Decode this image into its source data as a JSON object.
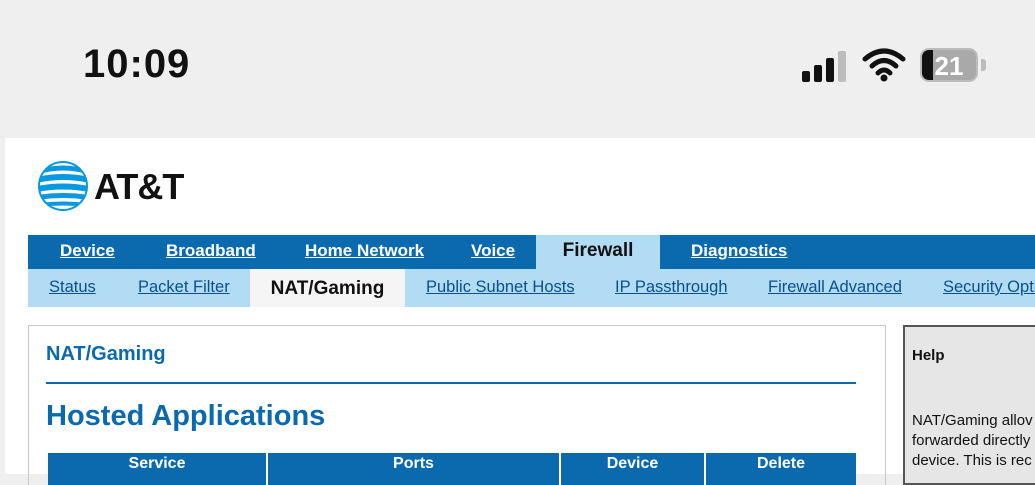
{
  "status_bar": {
    "time": "10:09",
    "battery": {
      "percent": 21,
      "label": "21"
    }
  },
  "brand": {
    "name": "AT&T",
    "color": "#0b6aad"
  },
  "main_nav": [
    {
      "label": "Device",
      "active": false
    },
    {
      "label": "Broadband",
      "active": false
    },
    {
      "label": "Home Network",
      "active": false
    },
    {
      "label": "Voice",
      "active": false
    },
    {
      "label": "Firewall",
      "active": true
    },
    {
      "label": "Diagnostics",
      "active": false
    }
  ],
  "sub_nav": [
    {
      "label": "Status",
      "active": false
    },
    {
      "label": "Packet Filter",
      "active": false
    },
    {
      "label": "NAT/Gaming",
      "active": true
    },
    {
      "label": "Public Subnet Hosts",
      "active": false
    },
    {
      "label": "IP Passthrough",
      "active": false
    },
    {
      "label": "Firewall Advanced",
      "active": false
    },
    {
      "label": "Security Opti",
      "active": false
    }
  ],
  "content": {
    "section_title": "NAT/Gaming",
    "heading": "Hosted Applications",
    "table_columns": [
      "Service",
      "Ports",
      "Device",
      "Delete"
    ]
  },
  "help": {
    "title": "Help",
    "lines": [
      "NAT/Gaming allov",
      "forwarded directly",
      "device. This is rec"
    ]
  },
  "colors": {
    "accent": "#0b6aad",
    "subnav_bg": "#b1dcf3"
  }
}
